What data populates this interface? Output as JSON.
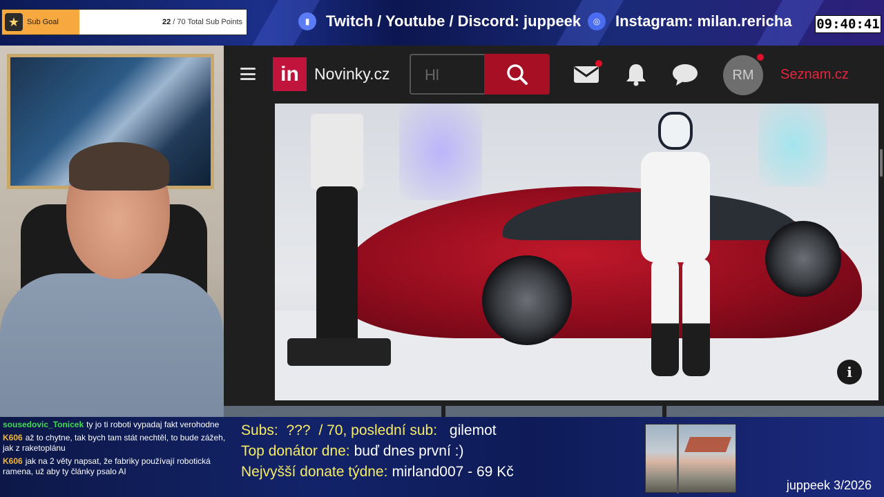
{
  "overlay": {
    "sub_goal": {
      "title": "Sub Goal",
      "current": "22",
      "suffix": "/ 70 Total Sub Points",
      "progress_fraction": 0.314,
      "fill_color": "#f7a940"
    },
    "socials": [
      {
        "text": "Twitch / Youtube / Discord: juppeek",
        "icon": "twitch-icon",
        "color": "#5b7cf5"
      },
      {
        "text": "Instagram: milan.rericha",
        "icon": "instagram-icon",
        "color": "#4a6cf0"
      }
    ],
    "clock": "09:40:41"
  },
  "browser": {
    "nav": {
      "logo_text": "in",
      "site_name": "Novinky.cz",
      "search_placeholder": "Hl",
      "avatar_initials": "RM",
      "seznam_link": "Seznam.cz",
      "accent": "#c0143c"
    },
    "info_label": "i"
  },
  "chat": [
    {
      "user": "sousedovic_Tonicek",
      "text": "ty jo ti roboti vypadaj fakt verohodne",
      "color": "green"
    },
    {
      "user": "K606",
      "text": "až to chytne, tak bych tam stát nechtěl, to bude zážeh, jak z raketoplánu",
      "color": "gold"
    },
    {
      "user": "K606",
      "text": "jak na 2 věty napsat, že fabriky používají robotická ramena, už aby ty články psalo AI",
      "color": "gold"
    }
  ],
  "stats": {
    "subs_label": "Subs:",
    "subs_value": "???",
    "subs_total": "/ 70, poslední sub:",
    "last_sub": "gilemot",
    "top_label": "Top donátor dne:",
    "top_value": "buď dnes první :)",
    "week_label": "Nejvyšší donate týdne:",
    "week_value": "mirland007 - 69 Kč"
  },
  "footer": {
    "brand": "juppeek 3/2026"
  }
}
